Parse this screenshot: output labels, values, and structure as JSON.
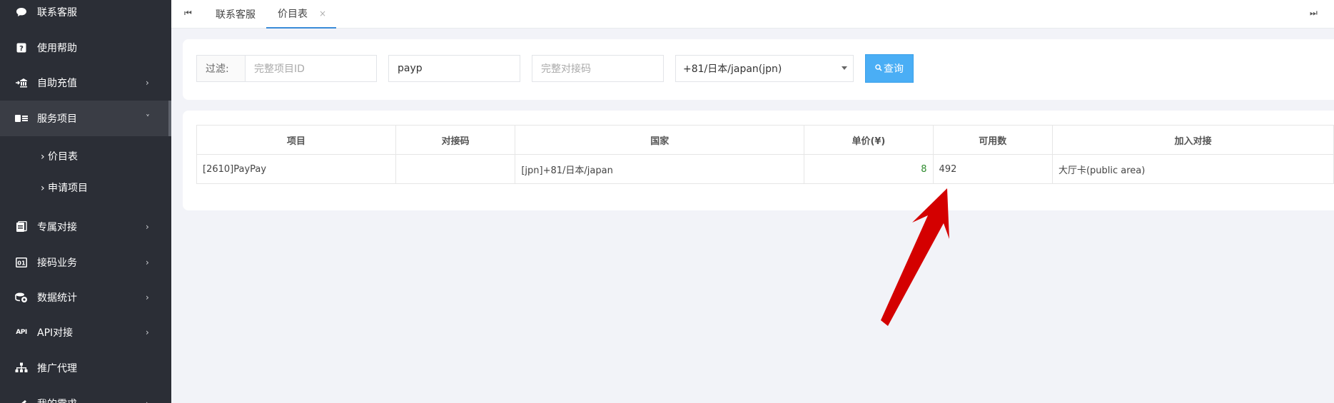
{
  "sidebar": {
    "items": [
      {
        "label": "联系客服",
        "icon": "chat-icon"
      },
      {
        "label": "使用帮助",
        "icon": "help-icon"
      },
      {
        "label": "自助充值",
        "icon": "recharge-icon",
        "arrow": "›"
      },
      {
        "label": "服务项目",
        "icon": "service-icon",
        "arrow": "˅"
      },
      {
        "label": "专属对接",
        "icon": "dedicated-icon",
        "arrow": "›"
      },
      {
        "label": "接码业务",
        "icon": "code-icon",
        "arrow": "›"
      },
      {
        "label": "数据统计",
        "icon": "stats-icon",
        "arrow": "›"
      },
      {
        "label": "API对接",
        "icon": "api-icon",
        "arrow": "›"
      },
      {
        "label": "推广代理",
        "icon": "promote-icon"
      },
      {
        "label": "我的需求",
        "icon": "demand-icon",
        "arrow": "›"
      }
    ],
    "sub_items": [
      {
        "label": "› 价目表"
      },
      {
        "label": "› 申请项目"
      }
    ],
    "api_badge": "API"
  },
  "tabs": {
    "items": [
      {
        "label": "联系客服"
      },
      {
        "label": "价目表",
        "close": "×"
      }
    ],
    "first_icon": "⏮",
    "last_icon": "⏭"
  },
  "filter": {
    "label": "过滤:",
    "project_id_placeholder": "完整项目ID",
    "payp_value": "payp",
    "code_placeholder": "完整对接码",
    "country_value": "+81/日本/japan(jpn)",
    "query_label": "查询",
    "query_icon": "🔍"
  },
  "table": {
    "headers": [
      "项目",
      "对接码",
      "国家",
      "单价(¥)",
      "可用数",
      "加入对接"
    ],
    "rows": [
      {
        "project": "[2610]PayPay",
        "code": "",
        "country": "[jpn]+81/日本/japan",
        "price": "8",
        "available": "492",
        "join": "大厅卡(public area)"
      }
    ]
  },
  "colors": {
    "sidebar_bg": "#2b2e36",
    "accent": "#4aaef5",
    "price_green": "#2e8b2e",
    "annotation_red": "#d40000"
  }
}
